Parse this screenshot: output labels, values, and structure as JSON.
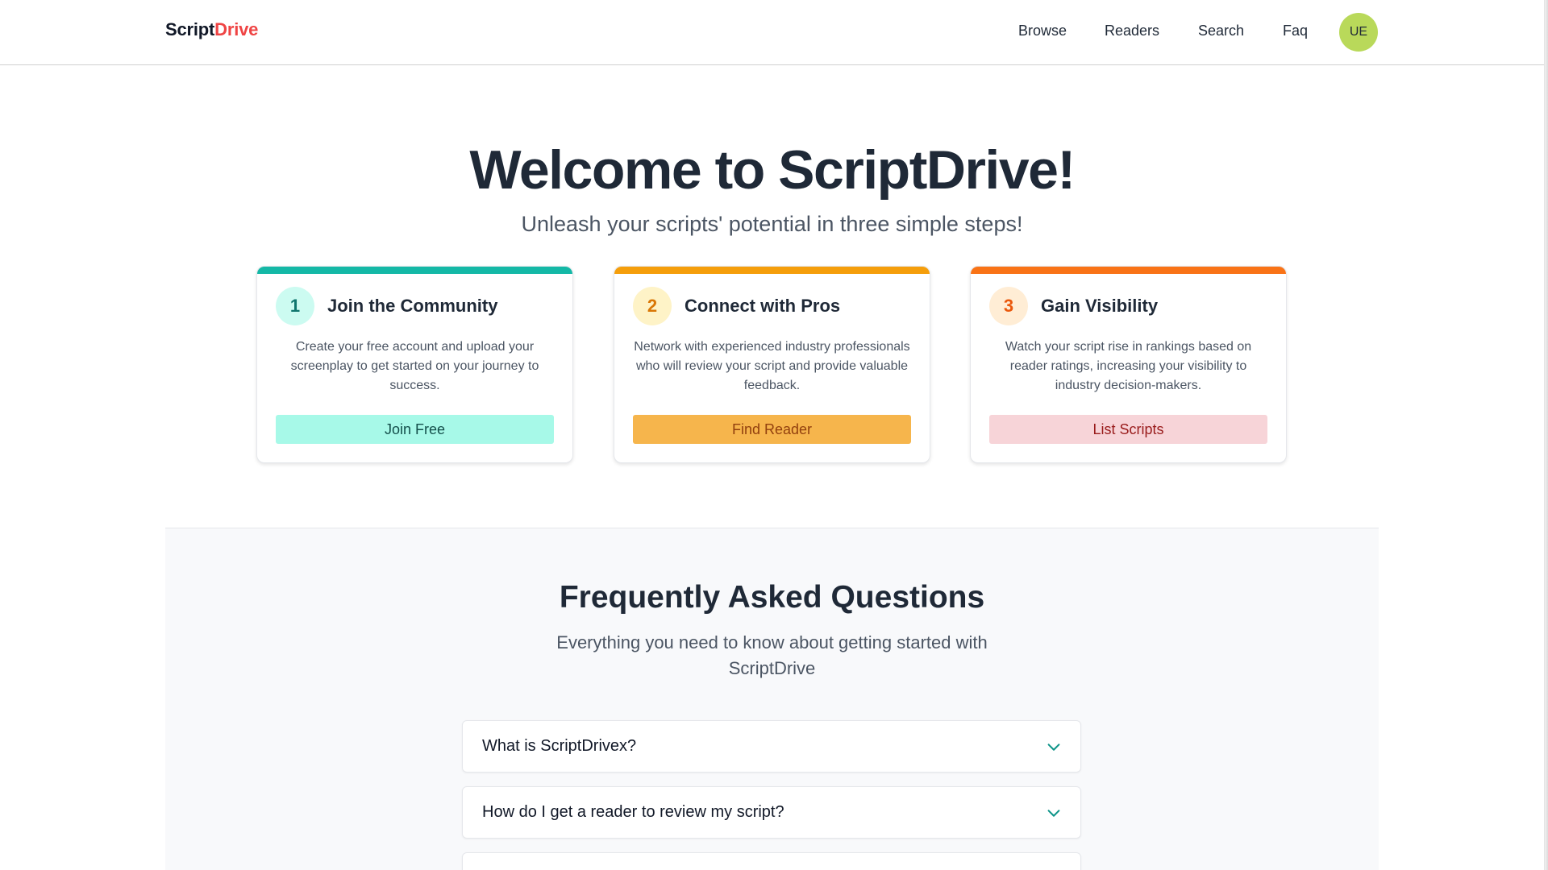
{
  "header": {
    "logo_main": "Script",
    "logo_accent": "Drive",
    "nav": [
      "Browse",
      "Readers",
      "Search",
      "Faq"
    ],
    "avatar_initials": "UE"
  },
  "hero": {
    "title": "Welcome to ScriptDrive!",
    "subtitle": "Unleash your scripts' potential in three simple steps!"
  },
  "steps": [
    {
      "number": "1",
      "title": "Join the Community",
      "description": "Create your free account and upload your screenplay to get started on your journey to success.",
      "button": "Join Free",
      "accent_color": "#14b8a6",
      "badge_bg": "#ccfbf1",
      "badge_fg": "#0f766e",
      "button_bg": "#a7f9e8",
      "button_fg": "#134e4a"
    },
    {
      "number": "2",
      "title": "Connect with Pros",
      "description": "Network with experienced industry professionals who will review your script and provide valuable feedback.",
      "button": "Find Reader",
      "accent_color": "#f59e0b",
      "badge_bg": "#fef3c7",
      "badge_fg": "#d97706",
      "button_bg": "#f6b54c",
      "button_fg": "#92400e"
    },
    {
      "number": "3",
      "title": "Gain Visibility",
      "description": "Watch your script rise in rankings based on reader ratings, increasing your visibility to industry decision-makers.",
      "button": "List Scripts",
      "accent_color": "#f97316",
      "badge_bg": "#ffedd5",
      "badge_fg": "#ea580c",
      "button_bg": "#f7d4d8",
      "button_fg": "#991b1b"
    }
  ],
  "faq": {
    "title": "Frequently Asked Questions",
    "subtitle": "Everything you need to know about getting started with ScriptDrive",
    "items": [
      "What is ScriptDrivex?",
      "How do I get a reader to review my script?",
      ""
    ],
    "chevron_color": "#0d9488"
  }
}
